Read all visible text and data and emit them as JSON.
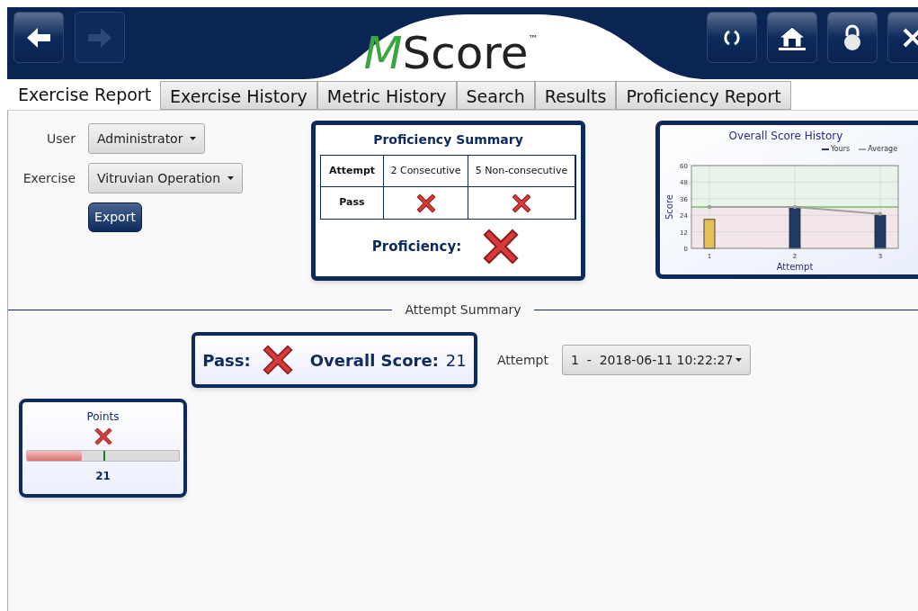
{
  "header": {
    "back_disabled": false,
    "forward_disabled": true,
    "logo": {
      "text": "MScore",
      "mark": "™"
    }
  },
  "tabs": [
    {
      "label": "Exercise Report",
      "selected": true
    },
    {
      "label": "Exercise History",
      "selected": false
    },
    {
      "label": "Metric History",
      "selected": false
    },
    {
      "label": "Search",
      "selected": false
    },
    {
      "label": "Results",
      "selected": false
    },
    {
      "label": "Proficiency Report",
      "selected": false
    }
  ],
  "filters": [
    {
      "label": "User",
      "value": "Administrator"
    },
    {
      "label": "Exercise",
      "value": "Vitruvian Operation"
    }
  ],
  "export_button": "Export",
  "proficiency_summary": {
    "title": "Proficiency Summary",
    "columns": [
      "Attempt",
      "2 Consecutive",
      "5 Non-consecutive"
    ],
    "row_label": "Pass",
    "cells": [
      {
        "passed": false
      },
      {
        "passed": false
      }
    ],
    "proficiency_label": "Proficiency:",
    "proficient": false
  },
  "score_history": {
    "chart_data": {
      "type": "bar",
      "grid": true,
      "title": "Overall Score History",
      "xlabel": "Attempt",
      "ylabel": "Score",
      "categories": [
        "1",
        "2",
        "3"
      ],
      "ylim": [
        0,
        60
      ],
      "yticks": [
        0,
        12,
        24,
        36,
        48,
        60
      ],
      "series": [
        {
          "name": "Yours",
          "color": "#1f3a66",
          "colors": [
            "#e3c158",
            "#1f3a66",
            "#1f3a66"
          ],
          "values": [
            21,
            30,
            24
          ]
        },
        {
          "name": "Average",
          "type": "line",
          "color": "#a0a0a0",
          "values": [
            30,
            30,
            25
          ]
        }
      ],
      "ref_lines": [
        {
          "axis": "y",
          "value": 30,
          "color": "#3aa83a"
        }
      ],
      "bands": [
        {
          "axis": "y",
          "from": 30,
          "to": 60,
          "color": "#e8f3ea"
        },
        {
          "axis": "y",
          "from": 0,
          "to": 30,
          "color": "#f3e6e8"
        }
      ]
    }
  },
  "attempt_summary": {
    "title": "Attempt Summary",
    "pass_label": "Pass:",
    "passed": false,
    "score_label": "Overall Score:",
    "score": "21",
    "attempt_label": "Attempt",
    "attempt_value": "1  -  2018-06-11 10:22:27"
  },
  "metrics": [
    {
      "name": "Points",
      "passed": false,
      "level": 0.36,
      "value": "21"
    }
  ]
}
